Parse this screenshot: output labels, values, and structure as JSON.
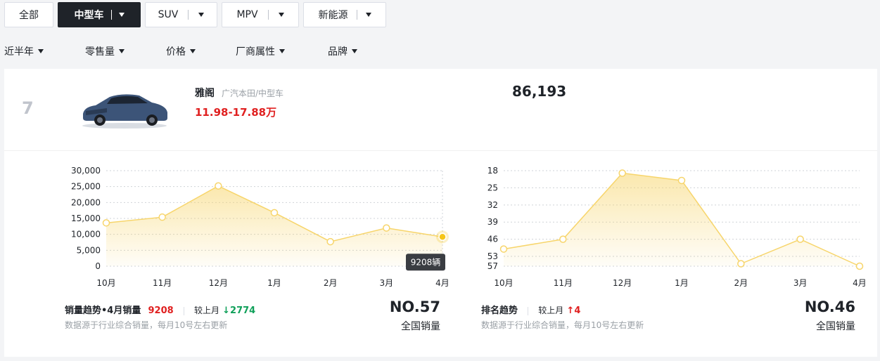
{
  "tabs": [
    {
      "label": "全部",
      "active": false,
      "dropdown": false
    },
    {
      "label": "中型车",
      "active": true,
      "dropdown": true
    },
    {
      "label": "SUV",
      "active": false,
      "dropdown": true
    },
    {
      "label": "MPV",
      "active": false,
      "dropdown": true
    },
    {
      "label": "新能源",
      "active": false,
      "dropdown": true
    }
  ],
  "filters": [
    "近半年",
    "零售量",
    "价格",
    "厂商属性",
    "品牌"
  ],
  "car": {
    "rank": "7",
    "name": "雅阁",
    "meta": "广汽本田/中型车",
    "price": "11.98-17.88万",
    "total_sales": "86,193",
    "image_icon": "car-image"
  },
  "colors": {
    "accent": "#f5c518",
    "line": "#f7d56b",
    "red": "#e02020",
    "green": "#10a05a",
    "dark": "#1f2329"
  },
  "sales_panel": {
    "title": "销量趋势•4月销量",
    "value": "9208",
    "compare_label": "较上月",
    "delta": "2774",
    "note": "数据源于行业综合销量，每月10号左右更新",
    "rank": "NO.57",
    "rank_label": "全国销量",
    "tooltip": "9208辆"
  },
  "rank_panel": {
    "title": "排名趋势",
    "compare_label": "较上月",
    "delta": "4",
    "note": "数据源于行业综合销量，每月10号左右更新",
    "rank": "NO.46",
    "rank_label": "全国销量"
  },
  "chart_data": [
    {
      "type": "area",
      "categories": [
        "10月",
        "11月",
        "12月",
        "1月",
        "2月",
        "3月",
        "4月"
      ],
      "values": [
        13600,
        15400,
        25200,
        16800,
        7700,
        12000,
        9208
      ],
      "ylim": [
        0,
        30000
      ],
      "yticks": [
        "0",
        "5,000",
        "10,000",
        "15,000",
        "20,000",
        "25,000",
        "30,000"
      ],
      "grid": true,
      "highlight_index": 6
    },
    {
      "type": "area",
      "categories": [
        "10月",
        "11月",
        "12月",
        "1月",
        "2月",
        "3月",
        "4月"
      ],
      "values": [
        50,
        46,
        19,
        22,
        56,
        46,
        57
      ],
      "ylim": [
        18,
        57
      ],
      "inverted": true,
      "yticks": [
        "18",
        "25",
        "32",
        "39",
        "46",
        "53",
        "57"
      ],
      "grid": true
    }
  ]
}
